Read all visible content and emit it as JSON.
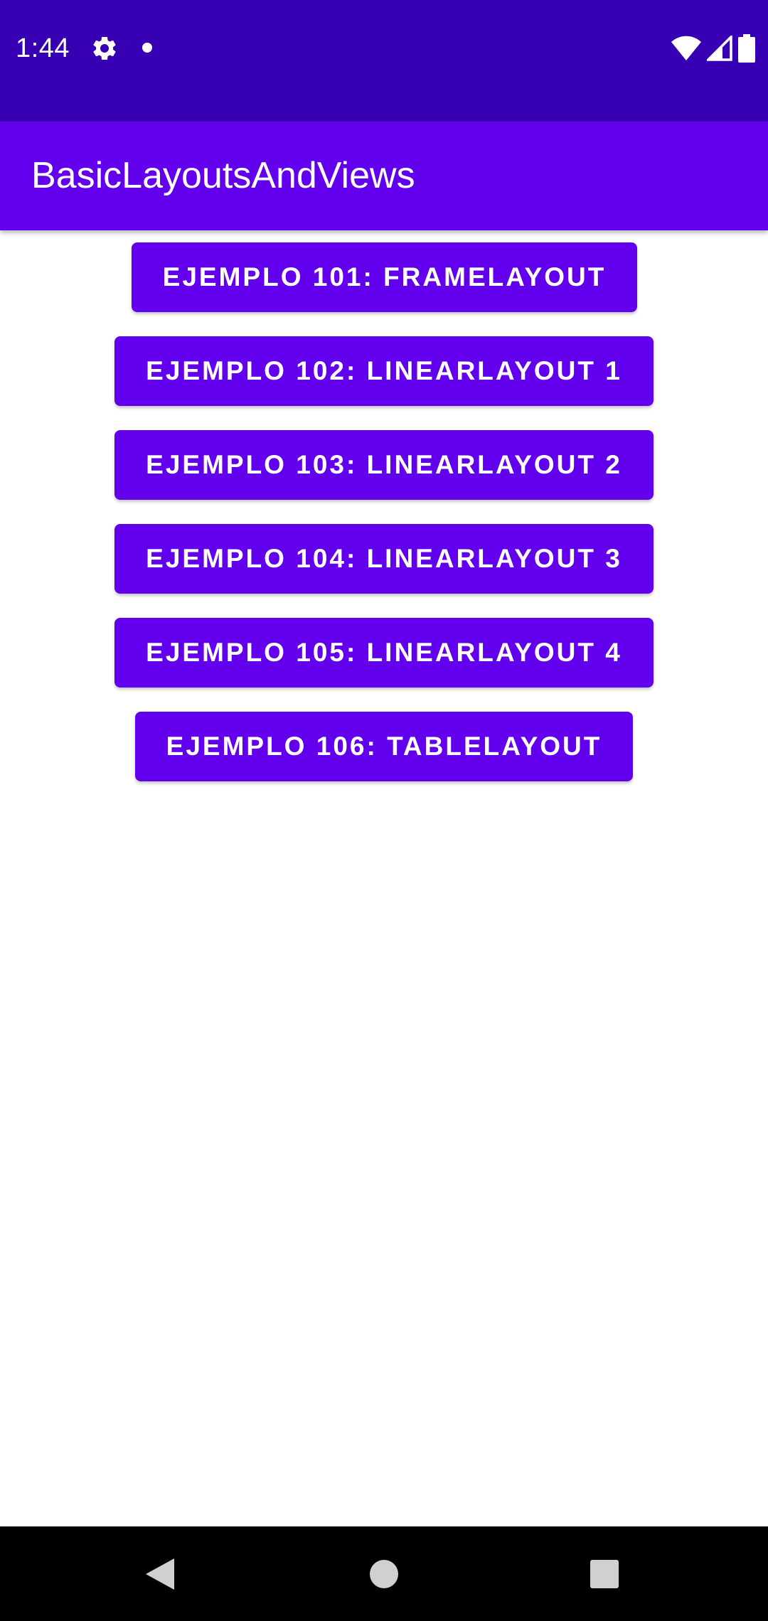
{
  "status_bar": {
    "time": "1:44",
    "icons": [
      "gear-icon",
      "notification-dot-icon",
      "wifi-icon",
      "cellular-signal-icon",
      "battery-icon"
    ],
    "background_color": "#3700b3"
  },
  "app_bar": {
    "title": "BasicLayoutsAndViews",
    "background_color": "#6200ee"
  },
  "buttons": [
    {
      "label": "EJEMPLO 101: FRAMELAYOUT"
    },
    {
      "label": "EJEMPLO 102: LINEARLAYOUT 1"
    },
    {
      "label": "EJEMPLO 103: LINEARLAYOUT 2"
    },
    {
      "label": "EJEMPLO 104: LINEARLAYOUT 3"
    },
    {
      "label": "EJEMPLO 105: LINEARLAYOUT 4"
    },
    {
      "label": "EJEMPLO 106: TABLELAYOUT"
    }
  ],
  "button_color": "#6200ee",
  "nav_bar": {
    "icons": [
      "back-icon",
      "home-icon",
      "recents-icon"
    ]
  }
}
